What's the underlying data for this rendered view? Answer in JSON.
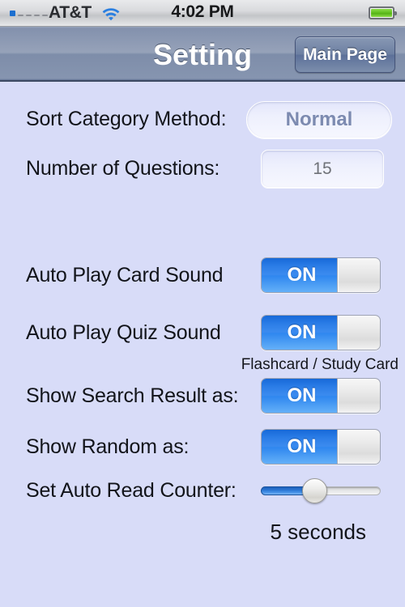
{
  "status_bar": {
    "signal_icon": "signal-bars-icon",
    "signal_filled_bars": 1,
    "signal_total_bars": 5,
    "carrier": "AT&T",
    "wifi_icon": "wifi-icon",
    "time": "4:02 PM",
    "battery_icon": "battery-full-icon"
  },
  "nav_bar": {
    "title": "Setting",
    "right_button_label": "Main Page"
  },
  "settings": {
    "sort_category": {
      "label": "Sort Category Method:",
      "value": "Normal"
    },
    "number_of_questions": {
      "label": "Number of Questions:",
      "value": "15"
    },
    "auto_play_card_sound": {
      "label": "Auto Play Card Sound",
      "toggle_state": "ON"
    },
    "auto_play_quiz_sound": {
      "label": "Auto Play Quiz Sound",
      "toggle_state": "ON",
      "note": "Flashcard / Study Card"
    },
    "show_search_result": {
      "label": "Show Search Result as:",
      "toggle_state": "ON"
    },
    "show_random": {
      "label": "Show Random as:",
      "toggle_state": "ON"
    },
    "auto_read_counter": {
      "label": "Set Auto Read Counter:",
      "value_text": "5 seconds",
      "slider_percent": 45
    }
  },
  "colors": {
    "background": "#d8dcf8",
    "nav_bar": "#8391ad",
    "toggle_on": "#3b8bef",
    "slider_fill": "#2f7bd8",
    "field_value_accent": "#7c8ab0"
  }
}
